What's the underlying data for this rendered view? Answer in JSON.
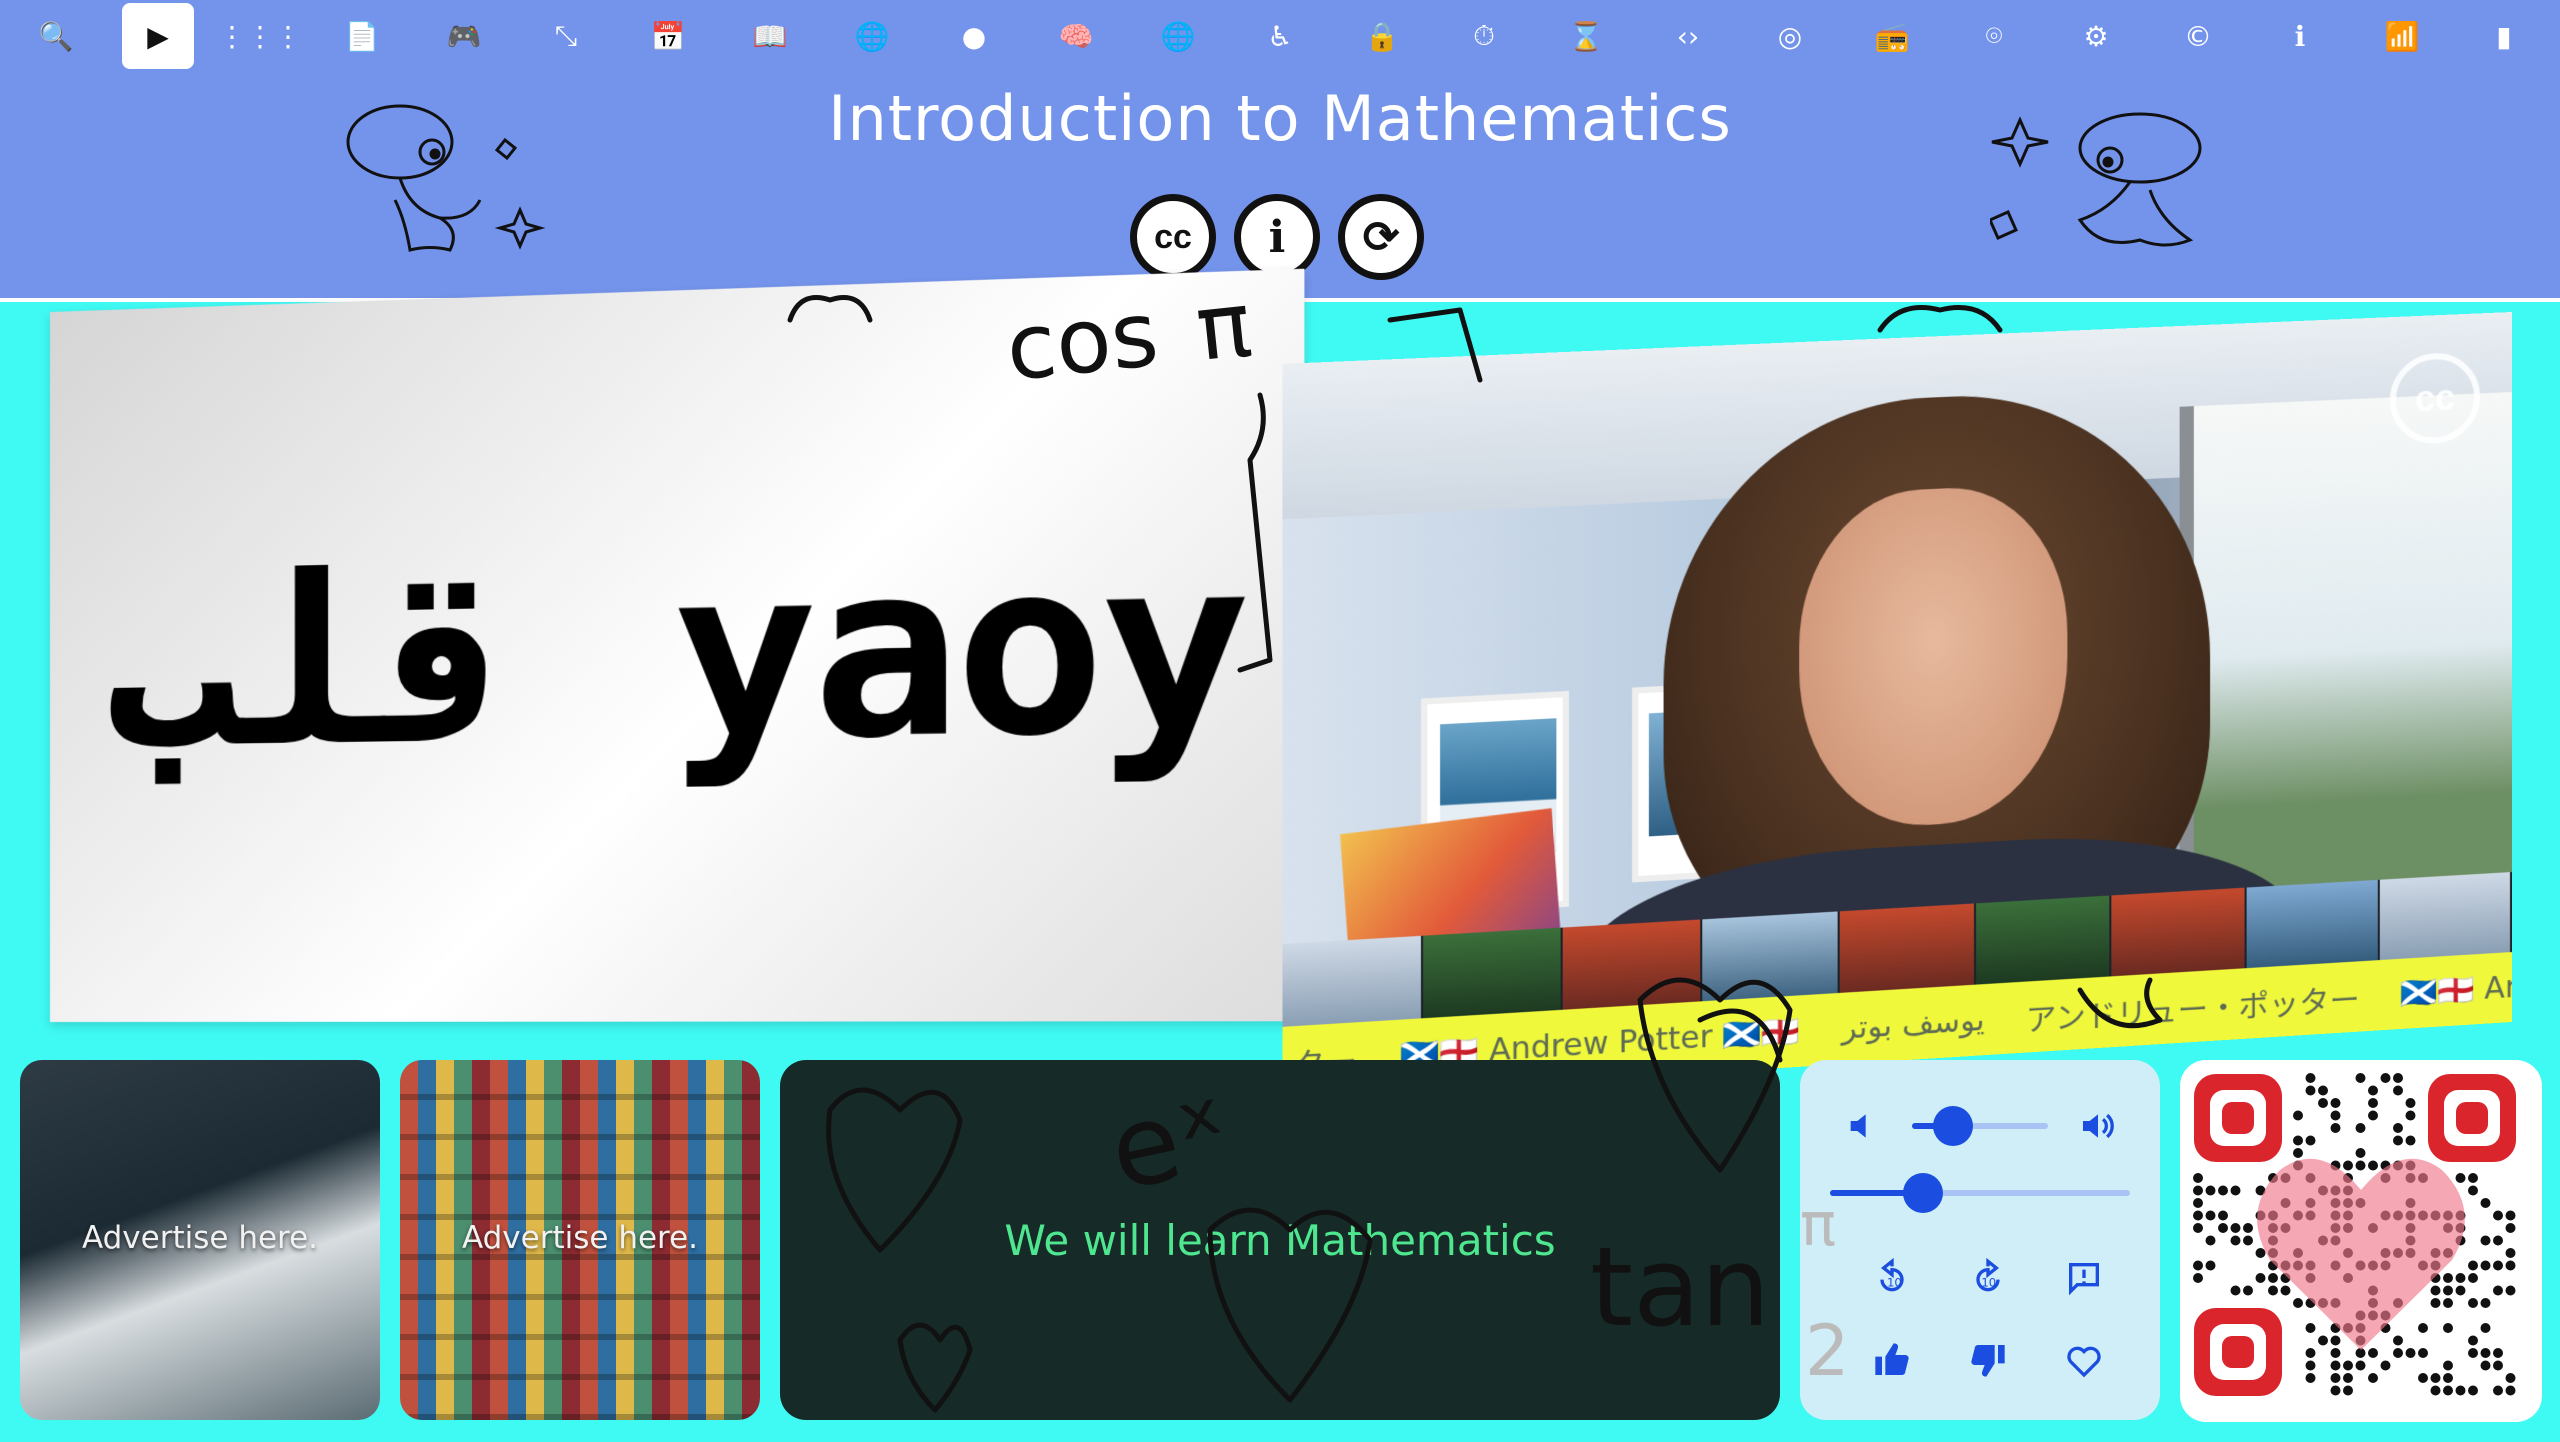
{
  "toolbar": {
    "items": [
      {
        "name": "search-icon",
        "glyph": "🔍"
      },
      {
        "name": "play-icon",
        "glyph": "▶",
        "active": true
      },
      {
        "name": "grid-icon",
        "glyph": "⋮⋮⋮"
      },
      {
        "name": "document-icon",
        "glyph": "📄"
      },
      {
        "name": "gamepad-icon",
        "glyph": "🎮"
      },
      {
        "name": "resize-icon",
        "glyph": "⤡"
      },
      {
        "name": "calendar-icon",
        "glyph": "📅"
      },
      {
        "name": "reader-icon",
        "glyph": "📖"
      },
      {
        "name": "globe-icon",
        "glyph": "🌐"
      },
      {
        "name": "avatar-icon",
        "glyph": "●"
      },
      {
        "name": "brain-icon",
        "glyph": "🧠"
      },
      {
        "name": "language-icon",
        "glyph": "🌐"
      },
      {
        "name": "accessibility-icon",
        "glyph": "♿"
      },
      {
        "name": "lock-icon",
        "glyph": "🔒"
      },
      {
        "name": "timer-icon",
        "glyph": "⏱"
      },
      {
        "name": "hourglass-icon",
        "glyph": "⌛"
      },
      {
        "name": "code-icon",
        "glyph": "‹›"
      },
      {
        "name": "target-icon",
        "glyph": "◎"
      },
      {
        "name": "radio-icon",
        "glyph": "📻"
      },
      {
        "name": "fingerprint-icon",
        "glyph": "⌾"
      },
      {
        "name": "gear-icon",
        "glyph": "⚙"
      },
      {
        "name": "copyright-icon",
        "glyph": "©"
      },
      {
        "name": "info-icon",
        "glyph": "ℹ"
      },
      {
        "name": "wifi-icon",
        "glyph": "📶"
      },
      {
        "name": "battery-icon",
        "glyph": "▮"
      }
    ]
  },
  "header": {
    "title": "Introduction to Mathematics",
    "badges": [
      {
        "name": "cc-badge",
        "label": "cc"
      },
      {
        "name": "attribution-badge",
        "label": "i"
      },
      {
        "name": "share-alike-badge",
        "label": "⟳"
      }
    ]
  },
  "slide": {
    "word": "قلب yaoy"
  },
  "video": {
    "watermark": "cc",
    "ticker": [
      "ター",
      "🏴󠁧󠁢󠁳󠁣󠁴󠁿🏴󠁧󠁢󠁥󠁮󠁧󠁿 Andrew Potter 🏴󠁧󠁢󠁳󠁣󠁴󠁿🏴󠁧󠁢󠁥󠁮󠁧󠁿",
      "يوسف بوتر",
      "アンドリュー・ポッター",
      "🏴󠁧󠁢󠁳󠁣󠁴󠁿🏴󠁧󠁢󠁥󠁮󠁧󠁿 Andrew P"
    ]
  },
  "ads": [
    {
      "text": "Advertise here."
    },
    {
      "text": "Advertise here."
    }
  ],
  "caption": {
    "text": "We will learn Mathematics"
  },
  "controls": {
    "volume_level": 0.3,
    "progress_level": 0.31,
    "icons": [
      "volume-down-icon",
      "volume-up-icon",
      "rewind-10-icon",
      "forward-10-icon",
      "report-icon",
      "thumbs-up-icon",
      "thumbs-down-icon",
      "heart-icon"
    ]
  },
  "colors": {
    "header": "#7494ec",
    "background": "#3ff9f3",
    "caption_bg": "#162a28",
    "caption_text": "#4ee68e",
    "controls_accent": "#1b4de0",
    "ticker": "#eff83a"
  },
  "ink": {
    "formula_1": "eˣ",
    "formula_2": "tan",
    "formula_3": "π",
    "formula_4": "2",
    "formula_5": "cos",
    "formula_6": "π"
  }
}
